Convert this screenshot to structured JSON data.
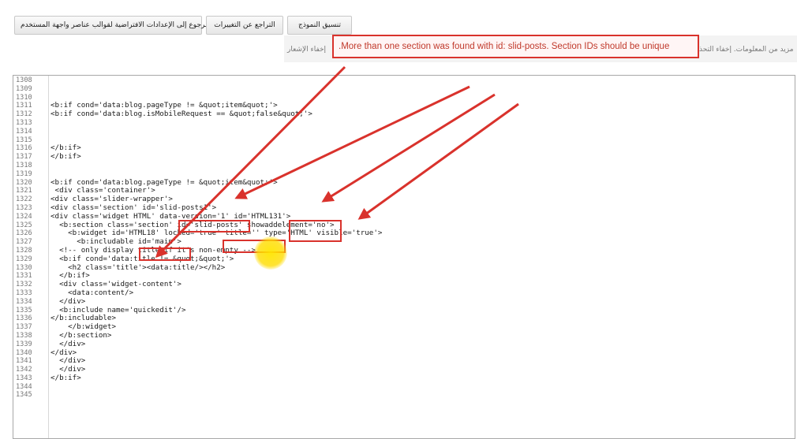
{
  "toolbar": {
    "buttons": [
      "الرجوع إلى الإعدادات الافتراضية لقوالب عناصر واجهة المستخدم",
      "التراجع عن التغييرات",
      "تنسيق النموذج"
    ]
  },
  "message": {
    "error_text": ".More than one section was found with id: slid-posts. Section IDs should be unique",
    "bg_left": "إخفاء الإشعار",
    "bg_right": "مزيد من المعلومات. إخفاء التحذ"
  },
  "editor": {
    "lines": [
      {
        "n": "1308",
        "c": ""
      },
      {
        "n": "1309",
        "c": ""
      },
      {
        "n": "1310",
        "c": ""
      },
      {
        "n": "1311",
        "c": "<b:if cond='data:blog.pageType != &quot;item&quot;'>"
      },
      {
        "n": "1312",
        "c": "<b:if cond='data:blog.isMobileRequest == &quot;false&quot;'>"
      },
      {
        "n": "1313",
        "c": ""
      },
      {
        "n": "1314",
        "c": ""
      },
      {
        "n": "1315",
        "c": ""
      },
      {
        "n": "1316",
        "c": "</b:if>"
      },
      {
        "n": "1317",
        "c": "</b:if>"
      },
      {
        "n": "1318",
        "c": ""
      },
      {
        "n": "1319",
        "c": ""
      },
      {
        "n": "1320",
        "c": "<b:if cond='data:blog.pageType != &quot;item&quot;'>"
      },
      {
        "n": "1321",
        "c": " <div class='container'>"
      },
      {
        "n": "1322",
        "c": "<div class='slider-wrapper'>"
      },
      {
        "n": "1323",
        "c": "<div class='section' id='slid-posts1'>"
      },
      {
        "n": "1324",
        "c": "<div class='widget HTML' data-version='1' id='HTML131'>"
      },
      {
        "n": "1325",
        "c": "  <b:section class='section' id='slid-posts' showaddelement='no'>"
      },
      {
        "n": "1326",
        "c": "    <b:widget id='HTML18' locked='true' title='' type='HTML' visible='true'>"
      },
      {
        "n": "1327",
        "c": "      <b:includable id='main'>"
      },
      {
        "n": "1328",
        "c": "  <!-- only display title if it's non-empty -->"
      },
      {
        "n": "1329",
        "c": "  <b:if cond='data:title != &quot;&quot;'>"
      },
      {
        "n": "1330",
        "c": "    <h2 class='title'><data:title/></h2>"
      },
      {
        "n": "1331",
        "c": "  </b:if>"
      },
      {
        "n": "1332",
        "c": "  <div class='widget-content'>"
      },
      {
        "n": "1333",
        "c": "    <data:content/>"
      },
      {
        "n": "1334",
        "c": "  </div>"
      },
      {
        "n": "1335",
        "c": "  <b:include name='quickedit'/>"
      },
      {
        "n": "1336",
        "c": "</b:includable>"
      },
      {
        "n": "1337",
        "c": "    </b:widget>"
      },
      {
        "n": "1338",
        "c": "  </b:section>"
      },
      {
        "n": "1339",
        "c": "  </div>"
      },
      {
        "n": "1340",
        "c": "</div>"
      },
      {
        "n": "1341",
        "c": "  </div>"
      },
      {
        "n": "1342",
        "c": "  </div>"
      },
      {
        "n": "1343",
        "c": "</b:if>"
      },
      {
        "n": "1344",
        "c": ""
      },
      {
        "n": "1345",
        "c": ""
      }
    ]
  },
  "colors": {
    "highlight": "#d9322c",
    "error_text": "#c0392b",
    "cursor": "#ffe000"
  }
}
